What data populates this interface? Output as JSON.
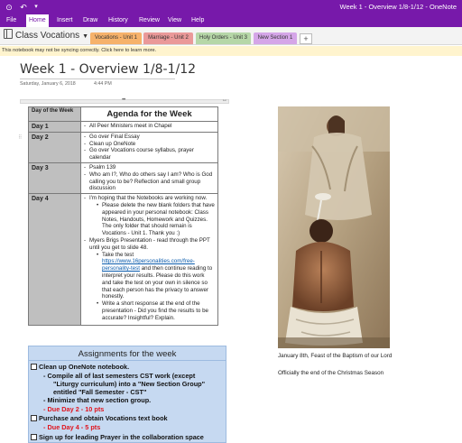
{
  "titlebar": {
    "window_title": "Week 1 - Overview 1/8-1/12  -  OneNote",
    "colors": {
      "brand": "#7719aa"
    }
  },
  "quick_access": {
    "back_icon": "back-arrow-icon",
    "undo_icon": "undo-icon",
    "more_icon": "chevron-down-icon"
  },
  "menu": {
    "items": [
      "File",
      "Home",
      "Insert",
      "Draw",
      "History",
      "Review",
      "View",
      "Help"
    ],
    "active": "Home"
  },
  "notebook": {
    "name": "Class Vocations"
  },
  "sections": [
    {
      "label": "Vocations - Unit 1",
      "color": "#f6b26b"
    },
    {
      "label": "Marriage - Unit 2",
      "color": "#ea9999"
    },
    {
      "label": "Holy Orders - Unit 3",
      "color": "#b6d7a8"
    },
    {
      "label": "New Section 1",
      "color": "#d5a6e8"
    }
  ],
  "add_section_label": "+",
  "notification": {
    "text": "This notebook may not be syncing correctly. Click here to learn more."
  },
  "page": {
    "title": "Week 1 - Overview 1/8-1/12",
    "date": "Saturday, January 6, 2018",
    "time": "4:44 PM"
  },
  "agenda": {
    "col_day_header": "Day of the Week",
    "col_agenda_header": "Agenda for the Week",
    "rows": {
      "day1": {
        "label": "Day 1",
        "items": [
          "All Peer Ministers meet in Chapel"
        ]
      },
      "day2": {
        "label": "Day 2",
        "items": [
          "Go over Final Essay",
          "Clean up OneNote",
          "Go over Vocations course syllabus, prayer calendar"
        ]
      },
      "day3": {
        "label": "Day 3",
        "items": [
          "Psalm 139",
          "Who am I?, Who do others say I am? Who is God calling you to be? Reflection and small group discussion"
        ]
      },
      "day4": {
        "label": "Day 4",
        "item1": "I'm hoping that the Notebooks are working now.",
        "item1_sub": "Please delete the new blank folders that have appeared in your personal notebook: Class Notes, Handouts, Homework and Quizzes. The only folder that should remain is Vocations - Unit 1. Thank you :)",
        "item2": "Myers Brigs Presentation - read through the PPT until you get to slide 48.",
        "item2_sub1_pre": "Take the test",
        "item2_sub1_link": "https://www.16personalities.com/free-personality-test",
        "item2_sub1_post": "and then continue reading to interpret your results. Please do this work and take the test on your own in silence so that each person has the privacy to answer honestly.",
        "item2_sub2": "Write a short response at the end of the presentation - Did you find the results to be accurate? Insightful? Explain."
      }
    }
  },
  "assignments": {
    "header": "Assignments for the week",
    "task1": "Clean up OneNote notebook.",
    "task1_a": "Compile all of last semesters CST work (except",
    "task1_b": "\"Liturgy curriculum) into a \"New Section Group\"",
    "task1_c": "entitled \"Fall Semester - CST\"",
    "task1_d": "Minimize that new section group.",
    "task1_due": "Due Day 2 - 10 pts",
    "task2": "Purchase and obtain Vocations text book",
    "task2_due": "Due Day 4 - 5 pts",
    "task3": "Sign up for leading Prayer in the collaboration space"
  },
  "image": {
    "caption": "January 8th, Feast of the Baptism of our Lord",
    "note": "Officially the end of the Christmas Season"
  }
}
